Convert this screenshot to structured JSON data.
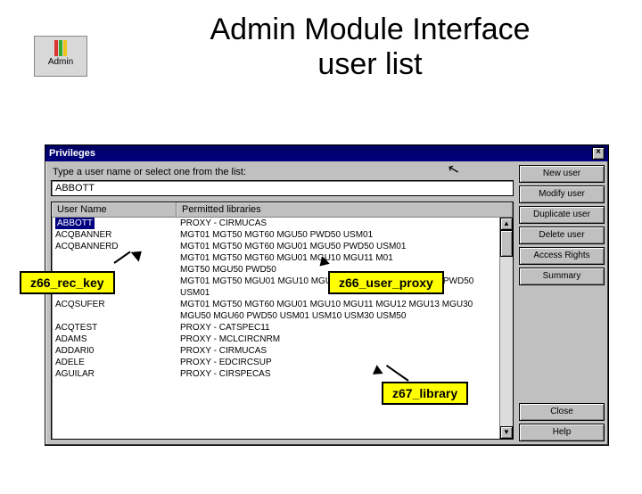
{
  "slide": {
    "title_line1": "Admin Module Interface",
    "title_line2": "user list"
  },
  "admin_chip": {
    "label": "Admin"
  },
  "window": {
    "title": "Privileges",
    "close_glyph": "×",
    "instruction": "Type a user name or select one from the list:",
    "input_value": "ABBOTT",
    "headers": {
      "user": "User Name",
      "perm": "Permitted libraries"
    },
    "buttons": {
      "new_user": "New user",
      "modify_user": "Modify user",
      "duplicate_user": "Duplicate user",
      "delete_user": "Delete user",
      "access_rights": "Access Rights",
      "summary": "Summary",
      "close": "Close",
      "help": "Help"
    },
    "scroll": {
      "up": "▲",
      "down": "▼"
    },
    "rows": [
      {
        "user": "ABBOTT",
        "selected": true,
        "perm": "PROXY - CIRMUCAS"
      },
      {
        "user": "ACQBANNER",
        "perm": "MGT01 MGT50 MGT60 MGU50 PWD50 USM01"
      },
      {
        "user": "ACQBANNERD",
        "perm": "MGT01 MGT50 MGT60 MGU01 MGU50 PWD50 USM01"
      },
      {
        "user": "",
        "perm": "MGT01 MGT50 MGT60 MGU01 MGU10 MGU11 M01"
      },
      {
        "user": "",
        "perm": "MGT50 MGU50 PWD50"
      },
      {
        "user": "",
        "perm": "MGT01 MGT50 MGU01 MGU10 MGU11 MGU12 MGU50 MGU30 PWD50 USM01"
      },
      {
        "user": "ACQSUFER",
        "perm": "MGT01 MGT50 MGT60 MGU01 MGU10 MGU11 MGU12 MGU13 MGU30 MGU50 MGU60 PWD50 USM01 USM10 USM30 USM50"
      },
      {
        "user": "ACQTEST",
        "perm": "PROXY - CATSPEC11"
      },
      {
        "user": "ADAMS",
        "perm": "PROXY - MCLCIRCNRM"
      },
      {
        "user": "ADDARI0",
        "perm": "PROXY - CIRMUCAS"
      },
      {
        "user": "ADELE",
        "perm": "PROXY - EDCIRCSUP"
      },
      {
        "user": "AGUILAR",
        "perm": "PROXY - CIRSPECAS"
      }
    ]
  },
  "callouts": {
    "rec_key": "z66_rec_key",
    "user_proxy": "z66_user_proxy",
    "library": "z67_library"
  }
}
